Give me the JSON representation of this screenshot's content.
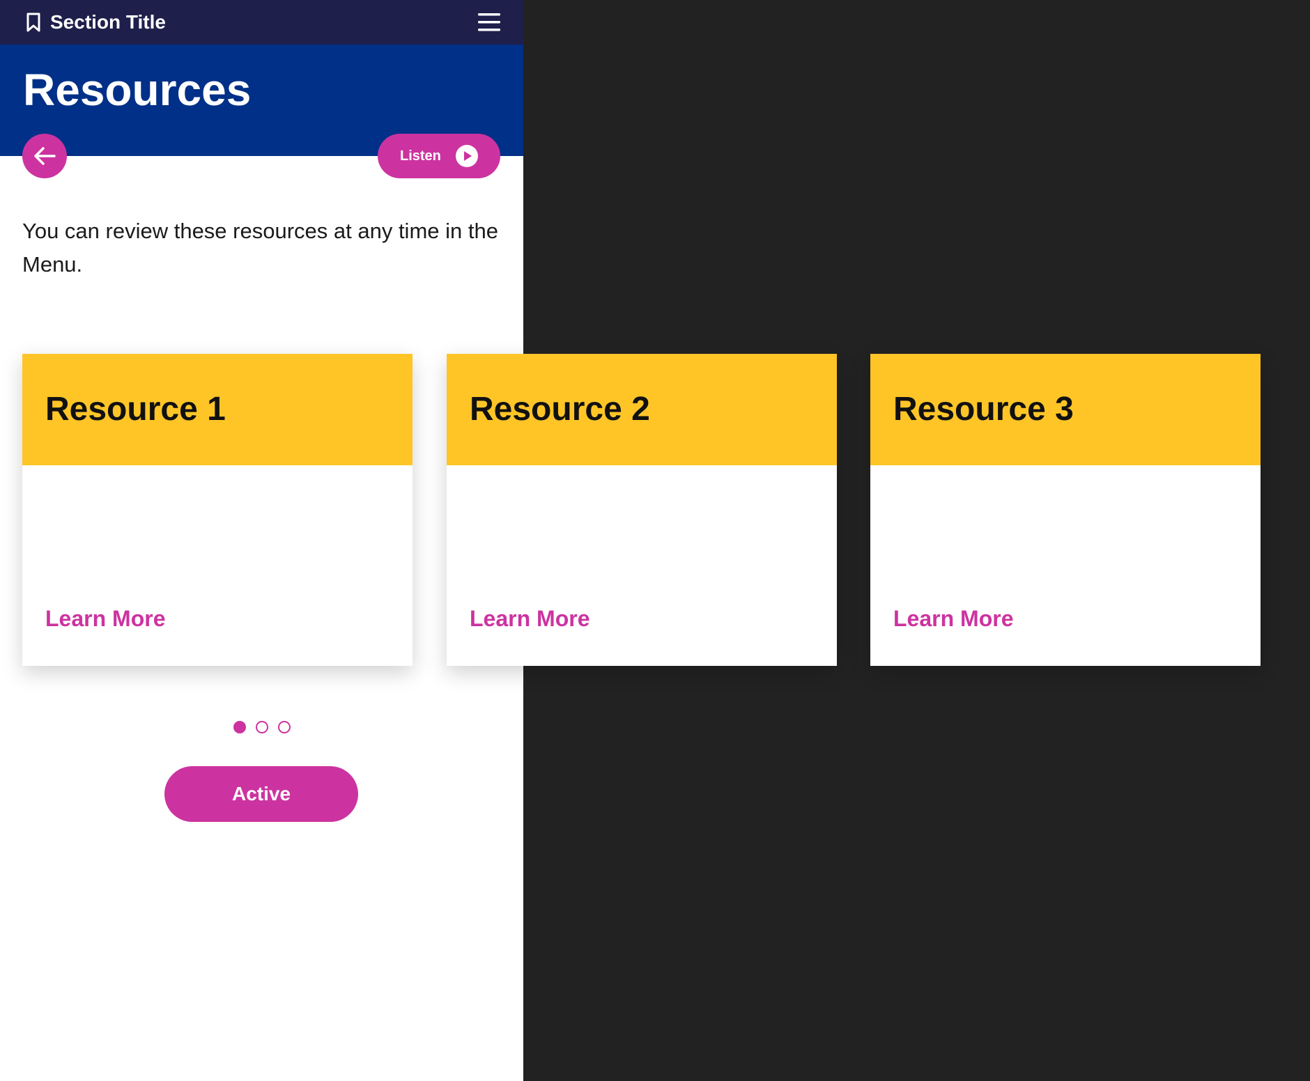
{
  "header": {
    "section_title": "Section Title",
    "bookmark_icon": "bookmark-icon",
    "menu_icon": "hamburger-menu-icon"
  },
  "banner": {
    "page_title": "Resources"
  },
  "controls": {
    "back_icon": "arrow-left-icon",
    "listen_label": "Listen",
    "play_icon": "play-icon"
  },
  "intro_text": "You can review these resources at any time in the Menu.",
  "cards": [
    {
      "title": "Resource 1",
      "link_label": "Learn More"
    },
    {
      "title": "Resource 2",
      "link_label": "Learn More"
    },
    {
      "title": "Resource 3",
      "link_label": "Learn More"
    }
  ],
  "pagination": {
    "total": 3,
    "current": 1
  },
  "active_button_label": "Active",
  "colors": {
    "top_bar": "#1e1f4b",
    "banner": "#003087",
    "accent": "#cc33a0",
    "card_header": "#ffc527",
    "backdrop": "#222222"
  }
}
